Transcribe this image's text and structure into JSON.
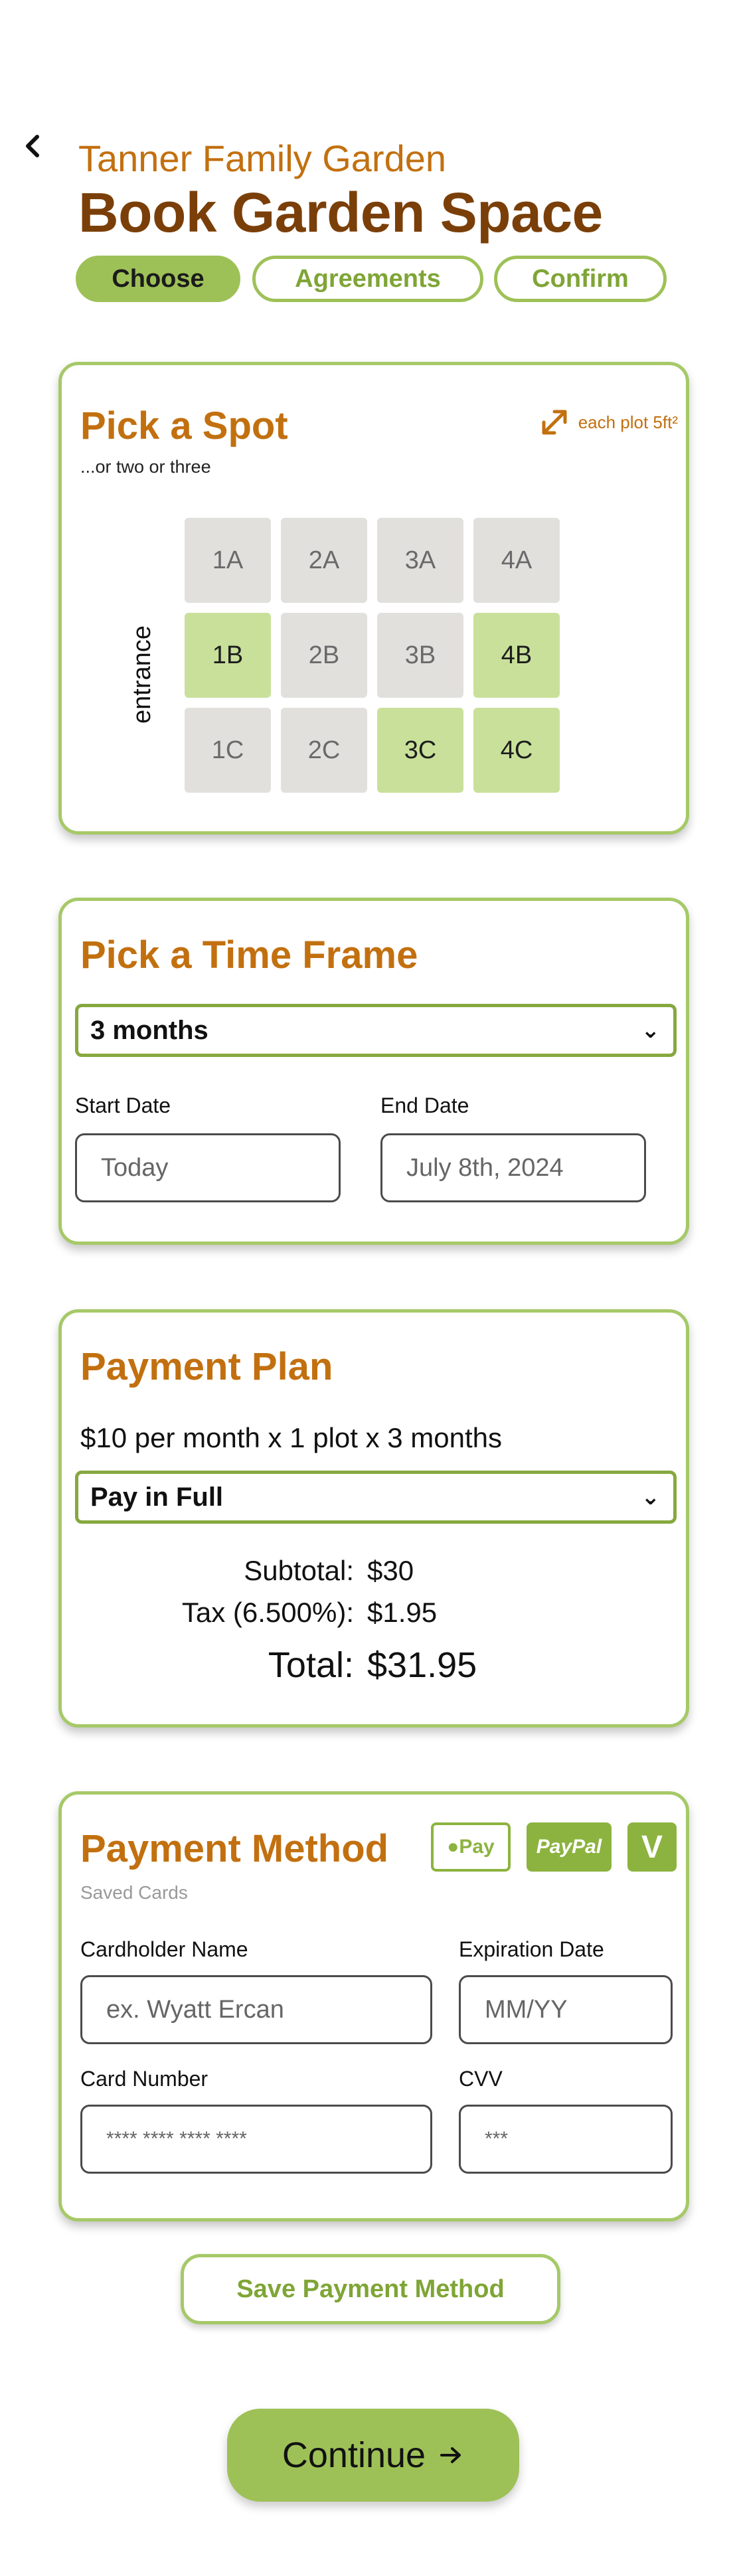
{
  "header": {
    "back_icon": "chevron-left-icon",
    "subtitle": "Tanner Family Garden",
    "title": "Book Garden Space"
  },
  "steps": [
    {
      "label": "Choose",
      "active": true
    },
    {
      "label": "Agreements",
      "active": false
    },
    {
      "label": "Confirm",
      "active": false
    }
  ],
  "spot": {
    "title": "Pick a Spot",
    "subtitle": "...or two or three",
    "plot_note": "each plot 5ft²",
    "plot_icon": "expand-arrows-icon",
    "entrance_label": "entrance",
    "plots": [
      {
        "id": "1A",
        "selected": false
      },
      {
        "id": "2A",
        "selected": false
      },
      {
        "id": "3A",
        "selected": false
      },
      {
        "id": "4A",
        "selected": false
      },
      {
        "id": "1B",
        "selected": true
      },
      {
        "id": "2B",
        "selected": false
      },
      {
        "id": "3B",
        "selected": false
      },
      {
        "id": "4B",
        "selected": true
      },
      {
        "id": "1C",
        "selected": false
      },
      {
        "id": "2C",
        "selected": false
      },
      {
        "id": "3C",
        "selected": true
      },
      {
        "id": "4C",
        "selected": true
      }
    ]
  },
  "time": {
    "title": "Pick a Time Frame",
    "duration": "3 months",
    "start_label": "Start Date",
    "start_value": "Today",
    "end_label": "End Date",
    "end_value": "July 8th, 2024"
  },
  "plan": {
    "title": "Payment Plan",
    "description": "$10 per month x 1 plot x 3 months",
    "option": "Pay in Full",
    "subtotal_label": "Subtotal:",
    "subtotal_value": "$30",
    "tax_label": "Tax (6.500%):",
    "tax_value": "$1.95",
    "total_label": "Total:",
    "total_value": "$31.95"
  },
  "method": {
    "title": "Payment Method",
    "saved_cards": "Saved Cards",
    "apple_pay": "Pay",
    "paypal": "PayPal",
    "venmo": "V",
    "cardholder_label": "Cardholder Name",
    "cardholder_placeholder": "ex. Wyatt Ercan",
    "expiration_label": "Expiration Date",
    "expiration_placeholder": "MM/YY",
    "card_number_label": "Card Number",
    "card_number_placeholder": "**** **** **** ****",
    "cvv_label": "CVV",
    "cvv_placeholder": "***"
  },
  "actions": {
    "save_payment": "Save Payment Method",
    "continue": "Continue"
  },
  "colors": {
    "accent_green": "#9ec157",
    "title_orange": "#c2700f",
    "title_brown": "#7a3f08"
  }
}
